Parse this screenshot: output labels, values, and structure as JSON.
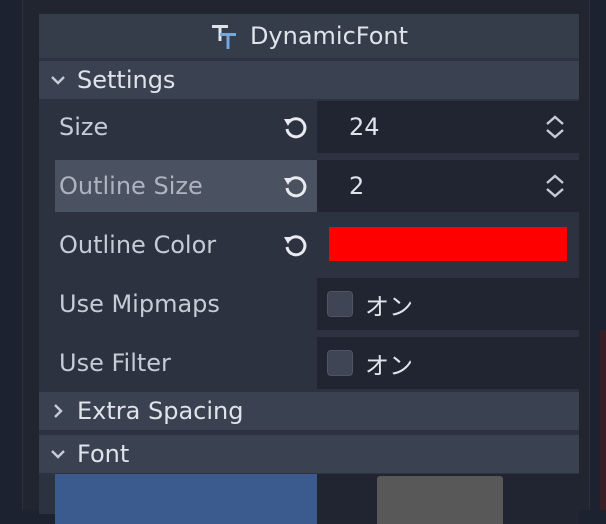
{
  "header": {
    "title": "DynamicFont",
    "icon": "dynamic-font-icon"
  },
  "sections": {
    "settings": {
      "label": "Settings",
      "expanded": true
    },
    "extra_spacing": {
      "label": "Extra Spacing",
      "expanded": false
    },
    "font": {
      "label": "Font",
      "expanded": true
    }
  },
  "properties": {
    "size": {
      "label": "Size",
      "value": "24"
    },
    "outline_size": {
      "label": "Outline Size",
      "value": "2"
    },
    "outline_color": {
      "label": "Outline Color",
      "color": "#ff0000"
    },
    "use_mipmaps": {
      "label": "Use Mipmaps",
      "checked": false,
      "toggle_label": "オン"
    },
    "use_filter": {
      "label": "Use Filter",
      "checked": false,
      "toggle_label": "オン"
    }
  },
  "colors": {
    "panel_bg": "#2c3240",
    "header_bg": "#363d4a",
    "section_bg": "#3a4150",
    "value_bg": "#202531",
    "highlight_bg": "#4a5160",
    "accent_blue": "#3b5a8e",
    "icon_blue": "#6ea9e6"
  }
}
